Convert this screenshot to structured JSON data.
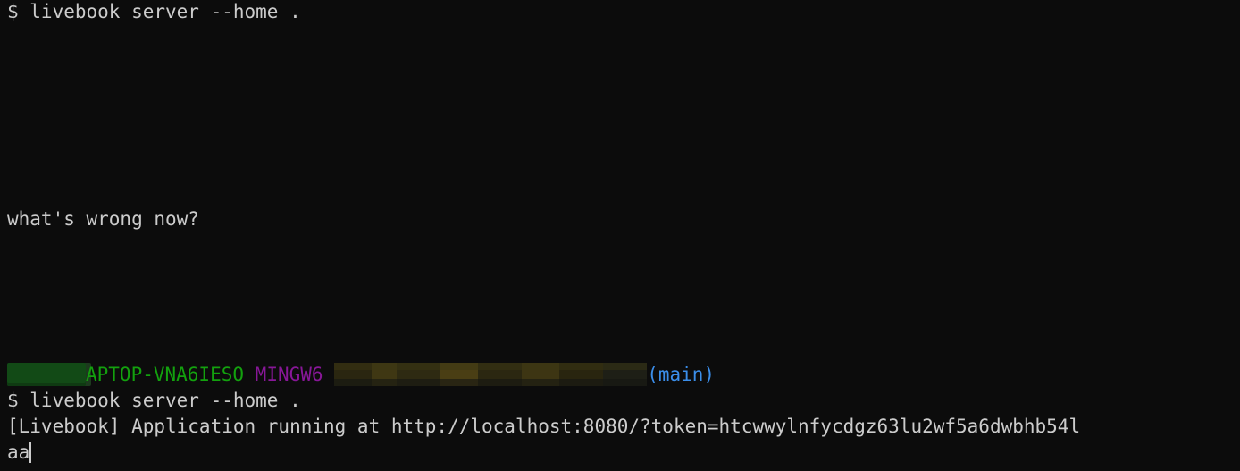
{
  "terminal": {
    "command_1": "$ livebook server --home .",
    "question": "what's wrong now?",
    "prompt": {
      "host": "APTOP-VNA6IESO",
      "shell": "MINGW6",
      "branch": "(main)"
    },
    "command_2": "$ livebook server --home .",
    "output": "[Livebook] Application running at http://localhost:8080/?token=htcwwylnfycdgz63lu2wf5a6dwbhb54l",
    "input_value": "aa"
  },
  "colors": {
    "background": "#0c0c0c",
    "foreground": "#cccccc",
    "host": "#13a10e",
    "shell": "#881798",
    "branch": "#3b8eea"
  }
}
